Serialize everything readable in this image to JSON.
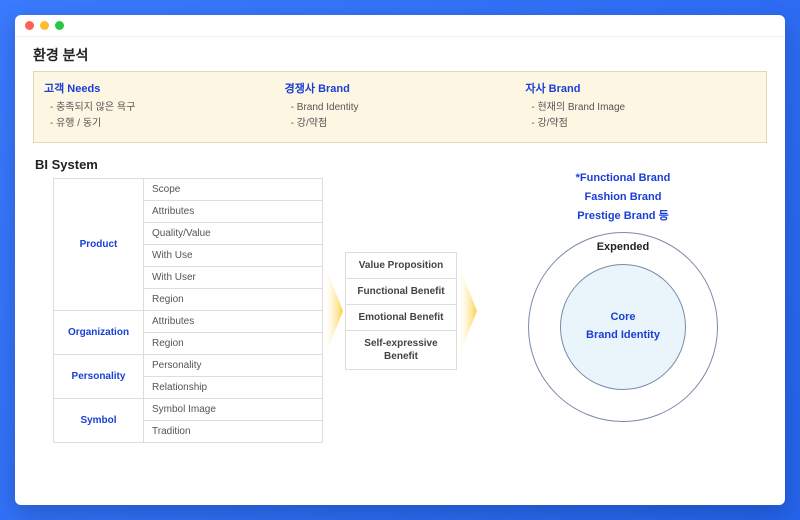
{
  "header": {
    "title": "환경 분석"
  },
  "env": {
    "cols": [
      {
        "title": "고객 Needs",
        "items": [
          "- 충족되지 않은 욕구",
          "- 유행 / 동기"
        ]
      },
      {
        "title": "경쟁사 Brand",
        "items": [
          "- Brand Identity",
          "- 강/약점"
        ]
      },
      {
        "title": "자사 Brand",
        "items": [
          "- 현재의 Brand Image",
          "- 강/약점"
        ]
      }
    ]
  },
  "bi": {
    "title": "BI System",
    "rows": [
      {
        "cat": "Product",
        "span": 6,
        "cells": [
          "Scope",
          "Attributes",
          "Quality/Value",
          "With Use",
          "With User",
          "Region"
        ]
      },
      {
        "cat": "Organization",
        "span": 2,
        "cells": [
          "Attributes",
          "Region"
        ]
      },
      {
        "cat": "Personality",
        "span": 2,
        "cells": [
          "Personality",
          "Relationship"
        ]
      },
      {
        "cat": "Symbol",
        "span": 2,
        "cells": [
          "Symbol Image",
          "Tradition"
        ]
      }
    ]
  },
  "benefits": [
    "Value Proposition",
    "Functional Benefit",
    "Emotional Benefit",
    "Self-expressive Benefit"
  ],
  "brands": [
    "*Functional Brand",
    "Fashion Brand",
    "Prestige Brand 등"
  ],
  "circle": {
    "outer": "Expended",
    "inner1": "Core",
    "inner2": "Brand Identity"
  }
}
